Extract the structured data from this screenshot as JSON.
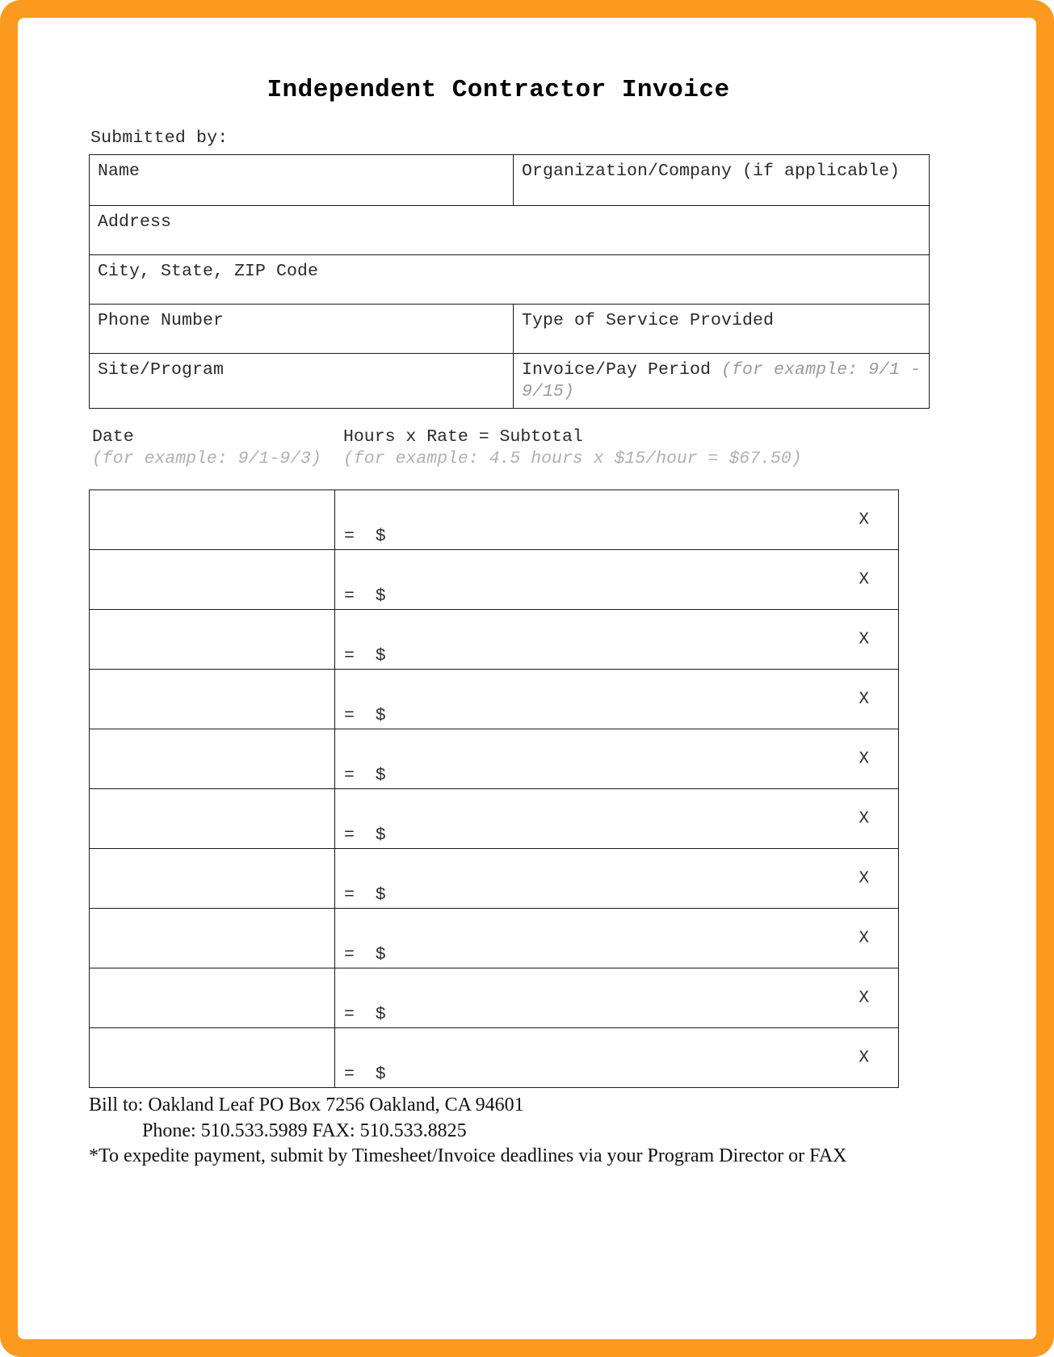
{
  "document": {
    "title": "Independent Contractor Invoice",
    "submitted_by_label": "Submitted by:"
  },
  "accent_colors": {
    "border_orange": "#FB9A1E",
    "rule_black": "#1a1a1a",
    "example_gray": "#b0b0b0"
  },
  "info_fields": {
    "name": "Name",
    "organization": "Organization/Company (if applicable)",
    "address": "Address",
    "city_state_zip": "City, State, ZIP Code",
    "phone_number": "Phone Number",
    "type_of_service": "Type of Service Provided",
    "site_program": "Site/Program",
    "invoice_pay_period": "Invoice/Pay Period ",
    "invoice_pay_period_example": "(for example: 9/1 - 9/15)"
  },
  "grid_header": {
    "date_label": "Date",
    "date_example": "(for example: 9/1-9/3)",
    "hours_label": "Hours x Rate = Subtotal",
    "hours_example": "(for example: 4.5 hours   x    $15/hour = $67.50)"
  },
  "row_marks": {
    "equals_dollar": "=  $",
    "multiply": "X"
  },
  "rows": [
    {
      "date": "",
      "calc": ""
    },
    {
      "date": "",
      "calc": ""
    },
    {
      "date": "",
      "calc": ""
    },
    {
      "date": "",
      "calc": ""
    },
    {
      "date": "",
      "calc": ""
    },
    {
      "date": "",
      "calc": ""
    },
    {
      "date": "",
      "calc": ""
    },
    {
      "date": "",
      "calc": ""
    },
    {
      "date": "",
      "calc": ""
    },
    {
      "date": "",
      "calc": ""
    }
  ],
  "footer": {
    "bill_to": "Bill to: Oakland Leaf PO Box 7256 Oakland, CA 94601",
    "phone_fax": "Phone: 510.533.5989 FAX: 510.533.8825",
    "note": "*To expedite payment, submit by Timesheet/Invoice deadlines via your Program Director or FAX"
  }
}
